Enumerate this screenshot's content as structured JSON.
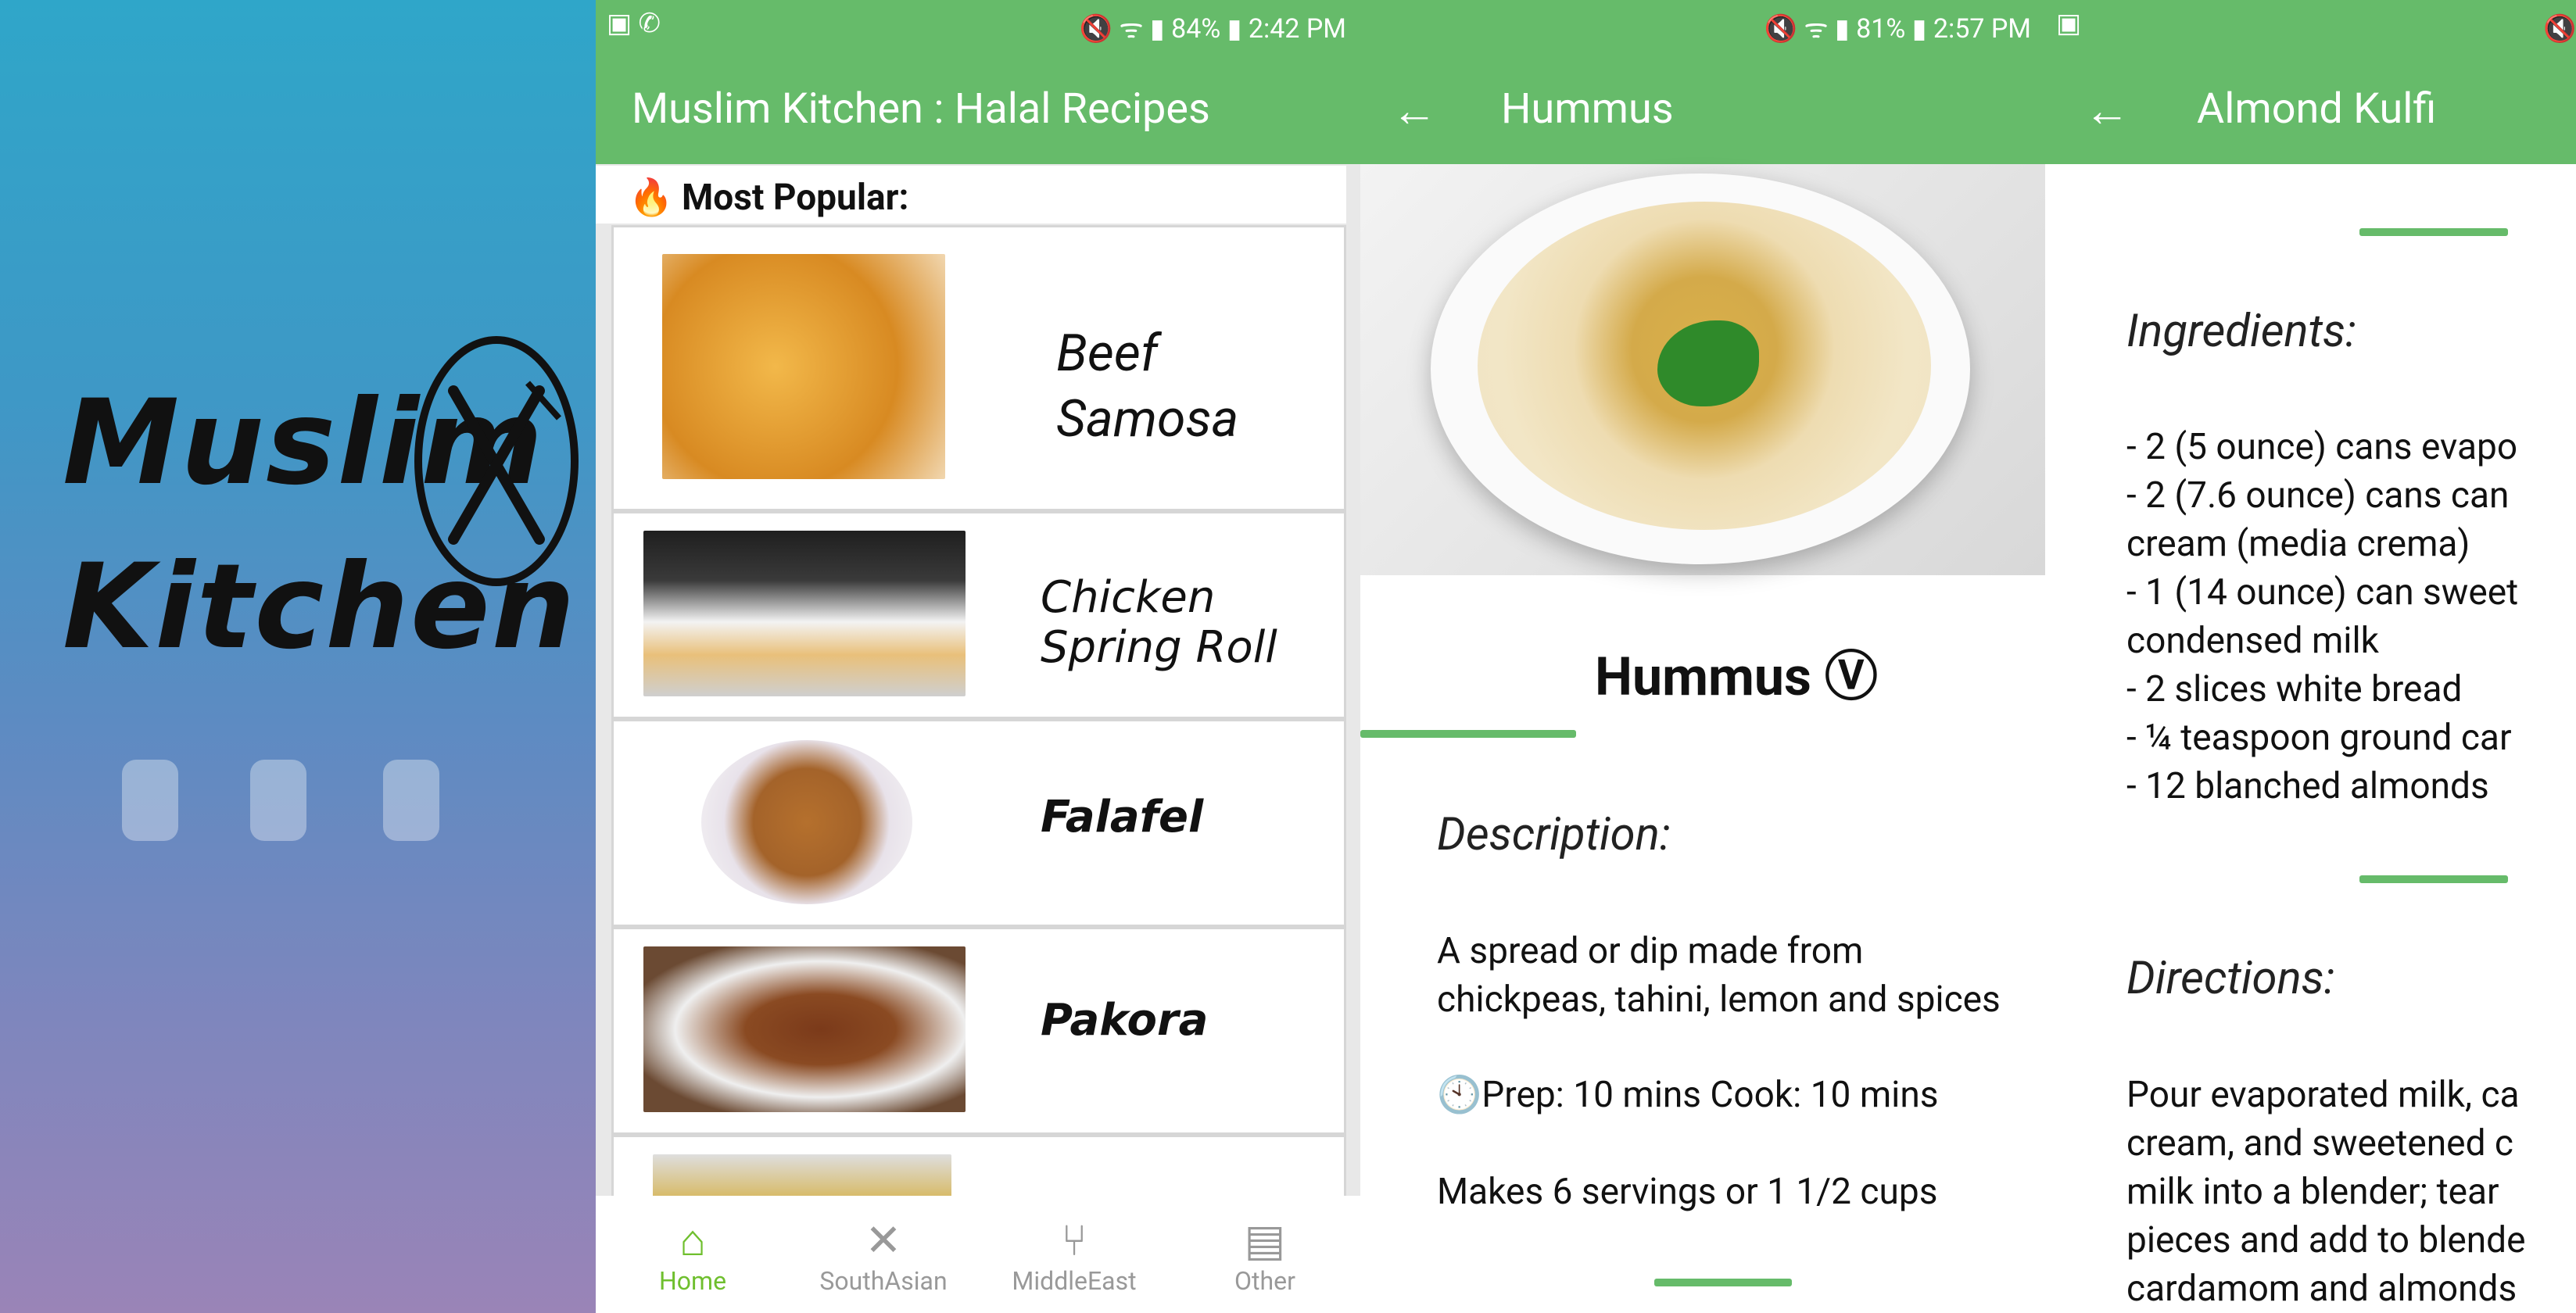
{
  "splash": {
    "logo_line1": "Muslim",
    "logo_line2": "Kitchen"
  },
  "home": {
    "status": {
      "battery": "84%",
      "time": "2:42 PM"
    },
    "title": "Muslim Kitchen : Halal Recipes",
    "section_label": "Most Popular:",
    "section_icon": "fire-icon",
    "recipes": [
      {
        "name_line1": "Beef",
        "name_line2": "Samosa"
      },
      {
        "name_line1": "Chicken",
        "name_line2": "Spring Roll"
      },
      {
        "name_line1": "Falafel",
        "name_line2": ""
      },
      {
        "name_line1": "Pakora",
        "name_line2": ""
      }
    ],
    "nav": [
      {
        "label": "Home",
        "icon": "home-icon",
        "active": true
      },
      {
        "label": "SouthAsian",
        "icon": "utensils-cross-icon",
        "active": false
      },
      {
        "label": "MiddleEast",
        "icon": "fork-knife-icon",
        "active": false
      },
      {
        "label": "Other",
        "icon": "fridge-icon",
        "active": false
      }
    ]
  },
  "hummus": {
    "status": {
      "battery": "81%",
      "time": "2:57 PM"
    },
    "title": "Hummus",
    "heading": "Hummus",
    "veg_mark": "Ⓥ",
    "description_title": "Description:",
    "description_line1": "A spread or dip made from",
    "description_line2": "chickpeas, tahini, lemon and spices",
    "prep": "Prep: 10 mins  Cook: 10 mins",
    "servings": "Makes 6 servings or 1 1/2 cups"
  },
  "kulfi": {
    "title": "Almond Kulfi",
    "ingredients_title": "Ingredients:",
    "ingredients": [
      "- 2 (5 ounce) cans evapo",
      "- 2 (7.6 ounce) cans can",
      "cream (media crema)",
      "- 1 (14 ounce) can sweet",
      "condensed milk",
      "- 2 slices white bread",
      "- ¼ teaspoon ground car",
      "- 12 blanched almonds"
    ],
    "directions_title": "Directions:",
    "directions": [
      "Pour evaporated milk, ca",
      "cream, and sweetened c",
      "milk into a blender; tear",
      "pieces and add to blende",
      "cardamom and almonds"
    ]
  },
  "colors": {
    "primary": "#66bb6a",
    "nav_active": "#6fbf2e"
  }
}
